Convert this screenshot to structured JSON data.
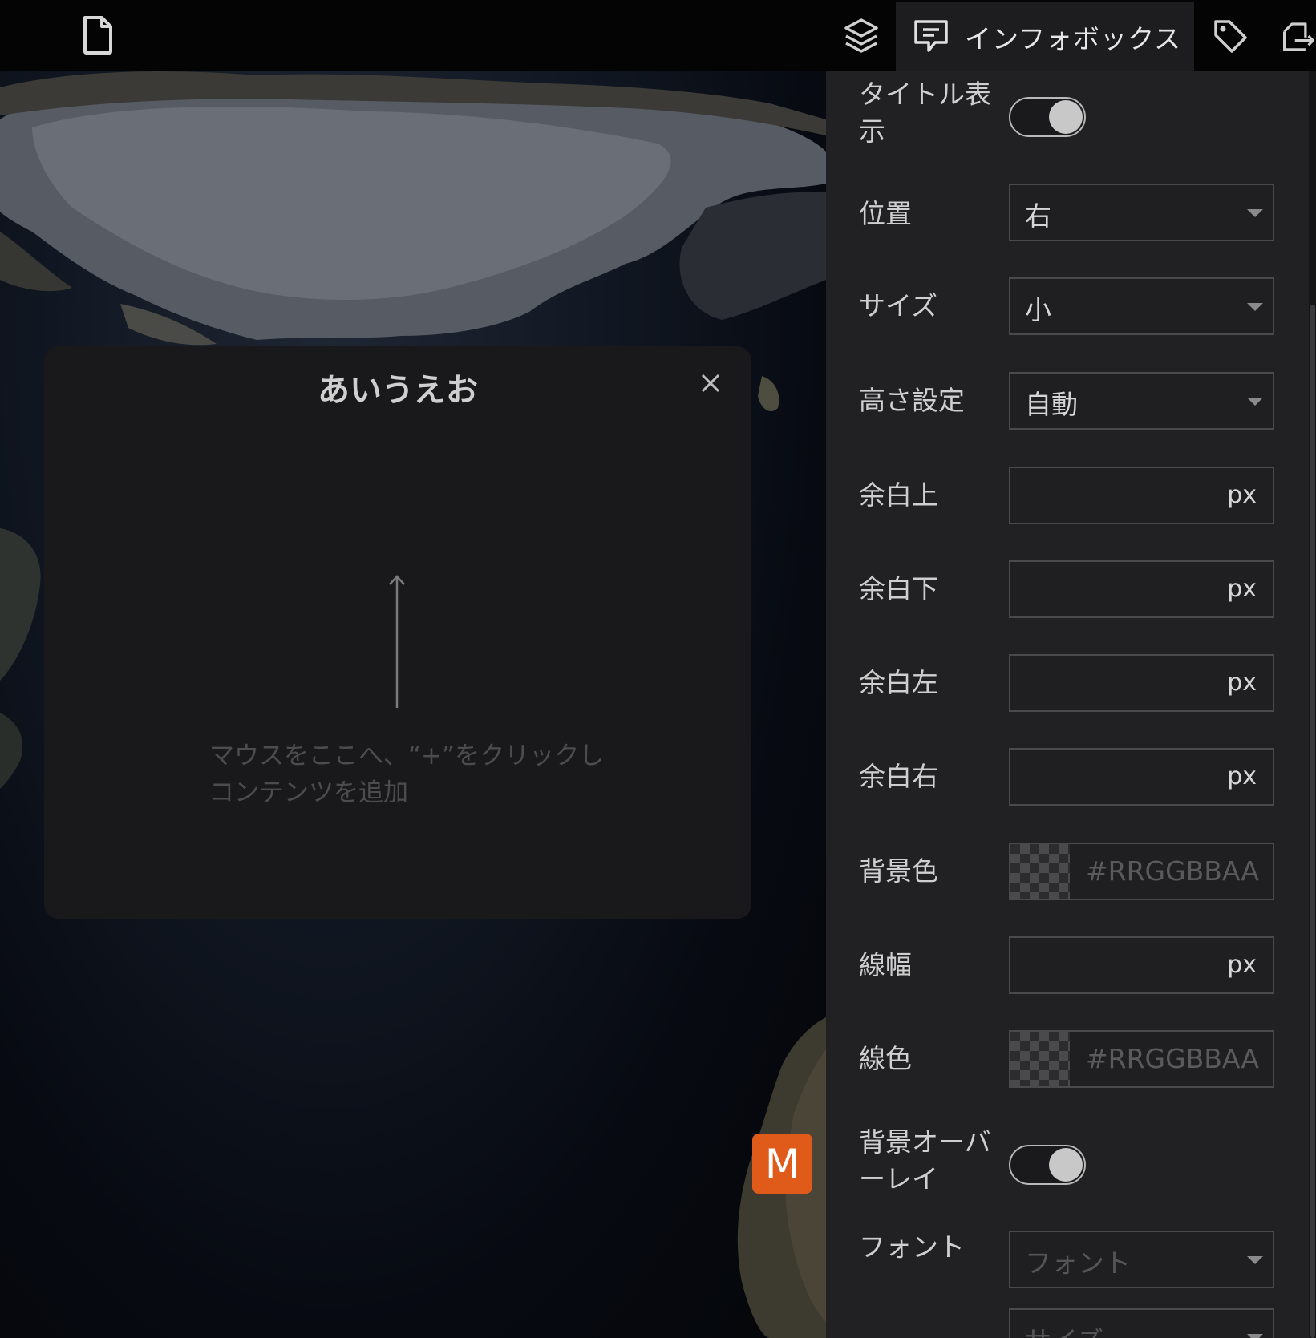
{
  "toolbar": {
    "file_icon": "file-icon",
    "layers_icon": "layers-icon",
    "infobox_tab_icon": "comment-box-icon",
    "infobox_tab_label": "インフォボックス",
    "tag_icon": "tag-icon",
    "export_icon": "export-icon"
  },
  "infobox": {
    "title": "あいうえお",
    "hint_line1": "マウスをここへ、“+”をクリックし",
    "hint_line2": "コンテンツを追加"
  },
  "map_badge": {
    "label": "M",
    "color": "#e05a1a"
  },
  "panel": {
    "title_display": {
      "label_line1": "タイトル表",
      "label_line2": "示",
      "on": true
    },
    "position": {
      "label": "位置",
      "value": "右"
    },
    "size": {
      "label": "サイズ",
      "value": "小"
    },
    "height": {
      "label": "高さ設定",
      "value": "自動"
    },
    "padding_top": {
      "label": "余白上",
      "unit": "px"
    },
    "padding_bottom": {
      "label": "余白下",
      "unit": "px"
    },
    "padding_left": {
      "label": "余白左",
      "unit": "px"
    },
    "padding_right": {
      "label": "余白右",
      "unit": "px"
    },
    "bg_color": {
      "label": "背景色",
      "placeholder": "#RRGGBBAA"
    },
    "line_width": {
      "label": "線幅",
      "unit": "px"
    },
    "line_color": {
      "label": "線色",
      "placeholder": "#RRGGBBAA"
    },
    "bg_overlay": {
      "label_line1": "背景オーバ",
      "label_line2": "ーレイ",
      "on": true
    },
    "font": {
      "label": "フォント",
      "placeholder": "フォント"
    },
    "font_size": {
      "placeholder": "サイズ"
    }
  }
}
